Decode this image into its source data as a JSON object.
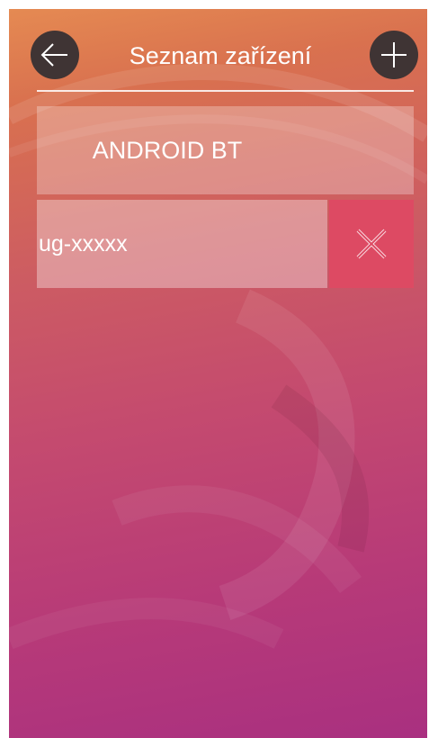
{
  "header": {
    "title": "Seznam zařízení",
    "back_icon": "arrow-left-icon",
    "add_icon": "plus-icon"
  },
  "tab": {
    "label": "ANDROID BT"
  },
  "devices": [
    {
      "name": "ug-xxxxx",
      "delete_icon": "close-icon"
    }
  ],
  "colors": {
    "icon_button_bg": "#3f3434",
    "delete_bg": "#dd4a63",
    "gradient_top": "#e58a52",
    "gradient_bottom": "#a93080"
  }
}
